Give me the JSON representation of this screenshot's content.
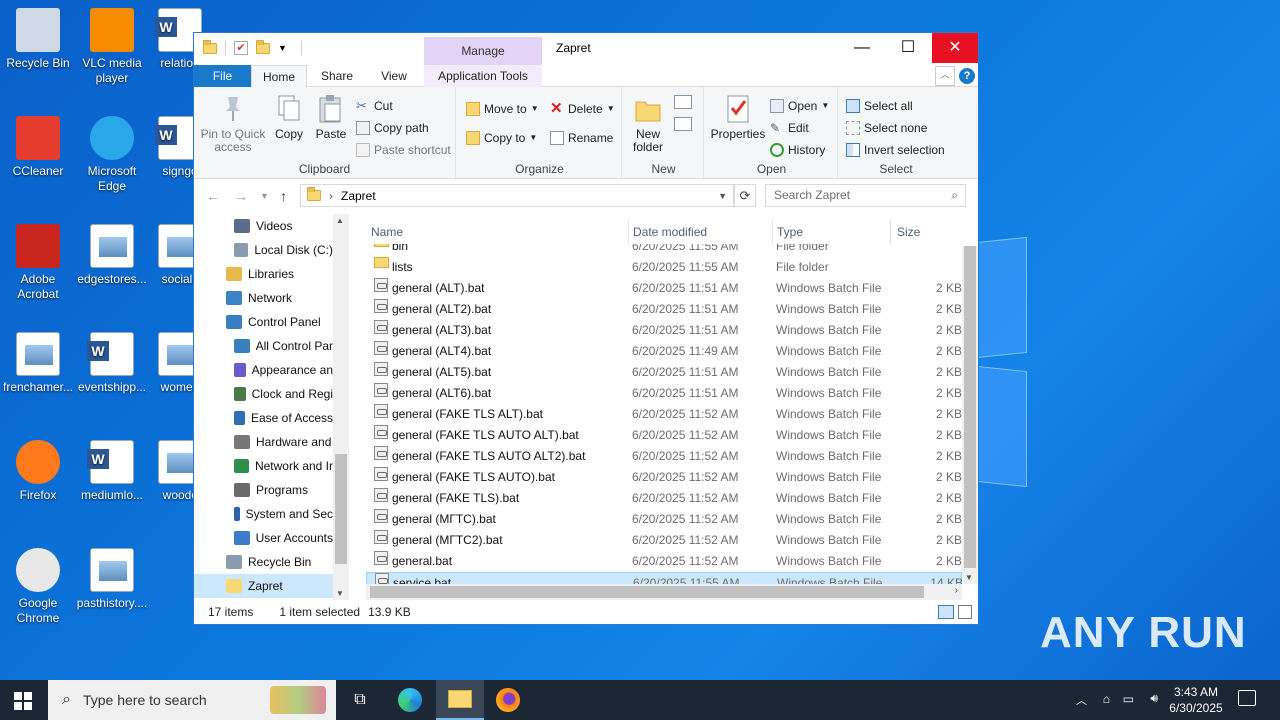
{
  "desktop": {
    "icons": [
      {
        "label": "Recycle Bin",
        "icon": "recycle-bin-icon"
      },
      {
        "label": "VLC media player",
        "icon": "vlc-icon"
      },
      {
        "label": "relation",
        "icon": "word-doc-icon"
      },
      {
        "label": "CCleaner",
        "icon": "ccleaner-icon"
      },
      {
        "label": "Microsoft Edge",
        "icon": "edge-icon"
      },
      {
        "label": "signgo",
        "icon": "word-doc-icon"
      },
      {
        "label": "Adobe Acrobat",
        "icon": "acrobat-icon"
      },
      {
        "label": "edgestores...",
        "icon": "image-file-icon"
      },
      {
        "label": "socialc",
        "icon": "image-file-icon"
      },
      {
        "label": "frenchamer...",
        "icon": "image-file-icon"
      },
      {
        "label": "eventshipp...",
        "icon": "word-doc-icon"
      },
      {
        "label": "women",
        "icon": "image-file-icon"
      },
      {
        "label": "Firefox",
        "icon": "firefox-icon"
      },
      {
        "label": "mediumlo...",
        "icon": "word-doc-icon"
      },
      {
        "label": "woodc",
        "icon": "image-file-icon"
      },
      {
        "label": "Google Chrome",
        "icon": "chrome-icon"
      },
      {
        "label": "pasthistory....",
        "icon": "image-file-icon"
      }
    ],
    "watermark": "ANY RUN"
  },
  "window": {
    "title": "Zapret",
    "manage_label": "Manage",
    "tabs": {
      "file": "File",
      "home": "Home",
      "share": "Share",
      "view": "View",
      "app_tools": "Application Tools"
    },
    "ribbon": {
      "clipboard": {
        "label": "Clipboard",
        "pin": "Pin to Quick access",
        "copy": "Copy",
        "paste": "Paste",
        "cut": "Cut",
        "copy_path": "Copy path",
        "paste_shortcut": "Paste shortcut"
      },
      "organize": {
        "label": "Organize",
        "move_to": "Move to",
        "copy_to": "Copy to",
        "delete": "Delete",
        "rename": "Rename"
      },
      "new": {
        "label": "New",
        "new_folder": "New folder"
      },
      "open": {
        "label": "Open",
        "properties": "Properties",
        "open": "Open",
        "edit": "Edit",
        "history": "History"
      },
      "select": {
        "label": "Select",
        "select_all": "Select all",
        "select_none": "Select none",
        "invert": "Invert selection"
      }
    },
    "address": {
      "path": "Zapret",
      "search_placeholder": "Search Zapret"
    },
    "nav": [
      {
        "label": "Videos",
        "color": "#5a6b8c"
      },
      {
        "label": "Local Disk (C:)",
        "color": "#8a9bb0"
      },
      {
        "label": "Libraries",
        "color": "#e8b84a"
      },
      {
        "label": "Network",
        "color": "#3b82c4"
      },
      {
        "label": "Control Panel",
        "color": "#3a7fc0"
      },
      {
        "label": "All Control Par",
        "color": "#3a7fc0"
      },
      {
        "label": "Appearance an",
        "color": "#6a5acd"
      },
      {
        "label": "Clock and Regi",
        "color": "#4a7a4a"
      },
      {
        "label": "Ease of Access",
        "color": "#2d6fb5"
      },
      {
        "label": "Hardware and",
        "color": "#777777"
      },
      {
        "label": "Network and Ir",
        "color": "#2f8f4a"
      },
      {
        "label": "Programs",
        "color": "#6b6b6b"
      },
      {
        "label": "System and Sec",
        "color": "#2a62b0"
      },
      {
        "label": "User Accounts",
        "color": "#3d7cc9"
      },
      {
        "label": "Recycle Bin",
        "color": "#8a9bb0"
      },
      {
        "label": "Zapret",
        "color": "#f8d775"
      }
    ],
    "columns": {
      "name": "Name",
      "date": "Date modified",
      "type": "Type",
      "size": "Size"
    },
    "files": [
      {
        "name": "bin",
        "date": "6/20/2025 11:55 AM",
        "type": "File folder",
        "size": "",
        "kind": "folder"
      },
      {
        "name": "lists",
        "date": "6/20/2025 11:55 AM",
        "type": "File folder",
        "size": "",
        "kind": "folder"
      },
      {
        "name": "general (ALT).bat",
        "date": "6/20/2025 11:51 AM",
        "type": "Windows Batch File",
        "size": "2 KB",
        "kind": "bat"
      },
      {
        "name": "general (ALT2).bat",
        "date": "6/20/2025 11:51 AM",
        "type": "Windows Batch File",
        "size": "2 KB",
        "kind": "bat"
      },
      {
        "name": "general (ALT3).bat",
        "date": "6/20/2025 11:51 AM",
        "type": "Windows Batch File",
        "size": "2 KB",
        "kind": "bat"
      },
      {
        "name": "general (ALT4).bat",
        "date": "6/20/2025 11:49 AM",
        "type": "Windows Batch File",
        "size": "2 KB",
        "kind": "bat"
      },
      {
        "name": "general (ALT5).bat",
        "date": "6/20/2025 11:51 AM",
        "type": "Windows Batch File",
        "size": "2 KB",
        "kind": "bat"
      },
      {
        "name": "general (ALT6).bat",
        "date": "6/20/2025 11:51 AM",
        "type": "Windows Batch File",
        "size": "2 KB",
        "kind": "bat"
      },
      {
        "name": "general (FAKE TLS ALT).bat",
        "date": "6/20/2025 11:52 AM",
        "type": "Windows Batch File",
        "size": "2 KB",
        "kind": "bat"
      },
      {
        "name": "general (FAKE TLS AUTO ALT).bat",
        "date": "6/20/2025 11:52 AM",
        "type": "Windows Batch File",
        "size": "2 KB",
        "kind": "bat"
      },
      {
        "name": "general (FAKE TLS AUTO ALT2).bat",
        "date": "6/20/2025 11:52 AM",
        "type": "Windows Batch File",
        "size": "2 KB",
        "kind": "bat"
      },
      {
        "name": "general (FAKE TLS AUTO).bat",
        "date": "6/20/2025 11:52 AM",
        "type": "Windows Batch File",
        "size": "2 KB",
        "kind": "bat"
      },
      {
        "name": "general (FAKE TLS).bat",
        "date": "6/20/2025 11:52 AM",
        "type": "Windows Batch File",
        "size": "2 KB",
        "kind": "bat"
      },
      {
        "name": "general (МГТС).bat",
        "date": "6/20/2025 11:52 AM",
        "type": "Windows Batch File",
        "size": "2 KB",
        "kind": "bat"
      },
      {
        "name": "general (МГТС2).bat",
        "date": "6/20/2025 11:52 AM",
        "type": "Windows Batch File",
        "size": "2 KB",
        "kind": "bat"
      },
      {
        "name": "general.bat",
        "date": "6/20/2025 11:52 AM",
        "type": "Windows Batch File",
        "size": "2 KB",
        "kind": "bat"
      },
      {
        "name": "service.bat",
        "date": "6/20/2025 11:55 AM",
        "type": "Windows Batch File",
        "size": "14 KB",
        "kind": "bat",
        "selected": true
      }
    ],
    "status": {
      "items": "17 items",
      "selected": "1 item selected",
      "size": "13.9 KB"
    }
  },
  "taskbar": {
    "search_placeholder": "Type here to search",
    "time": "3:43 AM",
    "date": "6/30/2025"
  }
}
